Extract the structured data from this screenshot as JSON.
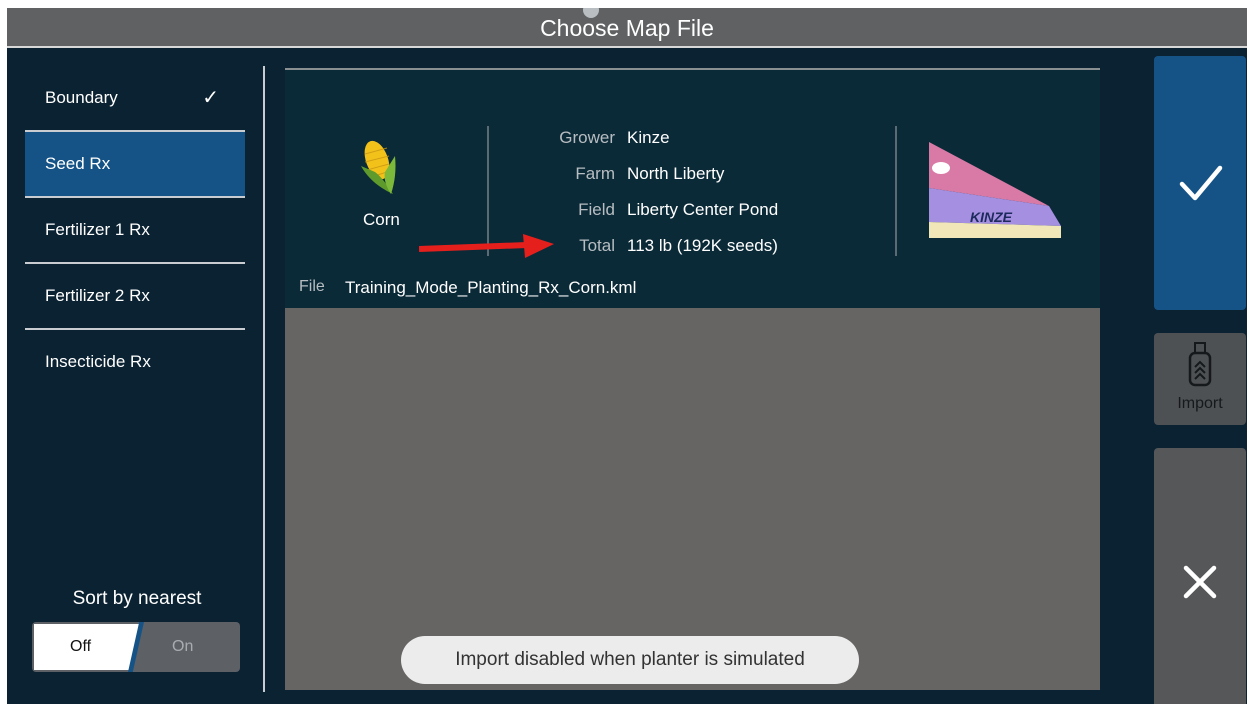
{
  "header": {
    "title": "Choose Map File"
  },
  "sidebar": {
    "items": [
      {
        "label": "Boundary",
        "checked": true
      },
      {
        "label": "Seed Rx",
        "selected": true
      },
      {
        "label": "Fertilizer 1 Rx"
      },
      {
        "label": "Fertilizer 2 Rx"
      },
      {
        "label": "Insecticide Rx"
      }
    ],
    "check_mark": "✓",
    "sort": {
      "label": "Sort by nearest",
      "off_label": "Off",
      "on_label": "On",
      "value": "Off"
    }
  },
  "details": {
    "crop": {
      "name": "Corn",
      "icon": "corn-icon"
    },
    "info": [
      {
        "key": "Grower",
        "value": "Kinze"
      },
      {
        "key": "Farm",
        "value": "North Liberty"
      },
      {
        "key": "Field",
        "value": "Liberty Center Pond"
      },
      {
        "key": "Total",
        "value": "113 lb (192K seeds)"
      }
    ],
    "file": {
      "key": "File",
      "value": "Training_Mode_Planting_Rx_Corn.kml"
    },
    "logo_text": "KINZE"
  },
  "toast": "Import disabled when planter is simulated",
  "actions": {
    "import_label": "Import",
    "confirm_icon": "checkmark-icon",
    "cancel_icon": "close-icon"
  },
  "colors": {
    "background": "#0b2232",
    "accent": "#155387",
    "title_bar": "#5f6163",
    "map_area": "#666564",
    "annotation_arrow": "#e5201c"
  }
}
